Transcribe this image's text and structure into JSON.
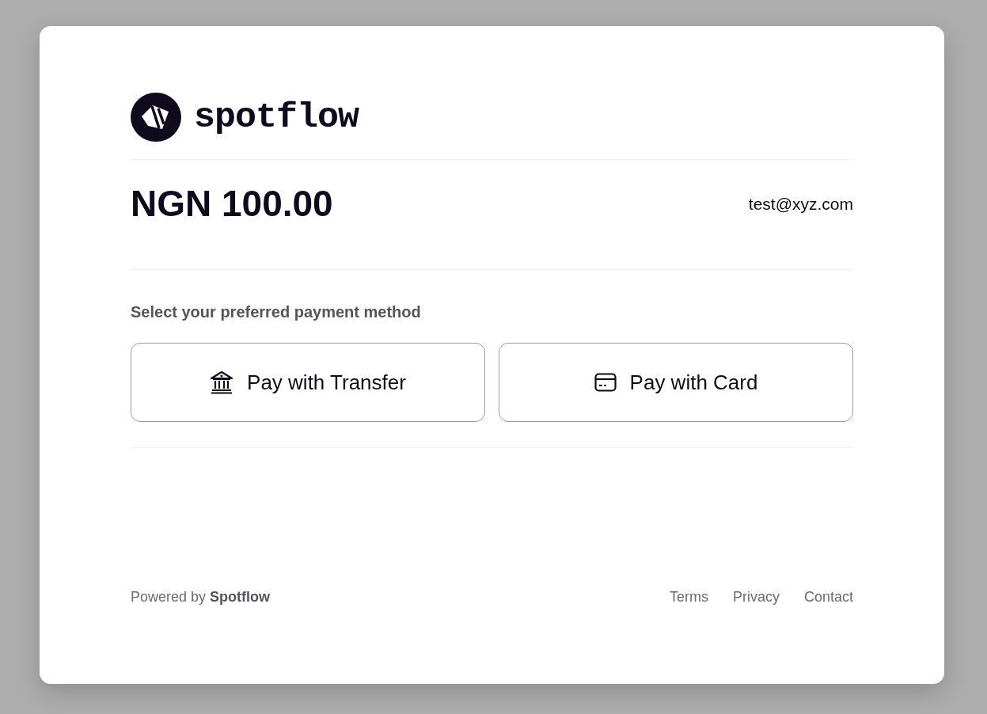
{
  "brand": {
    "name": "spotflow"
  },
  "summary": {
    "amount": "NGN 100.00",
    "email": "test@xyz.com"
  },
  "payment": {
    "prompt": "Select your preferred payment method",
    "methods": [
      {
        "kind": "transfer",
        "label": "Pay with Transfer"
      },
      {
        "kind": "card",
        "label": "Pay with Card"
      }
    ]
  },
  "footer": {
    "powered_by": "Powered by **Spotflow**",
    "links": [
      "Terms",
      "Privacy",
      "Contact"
    ]
  }
}
